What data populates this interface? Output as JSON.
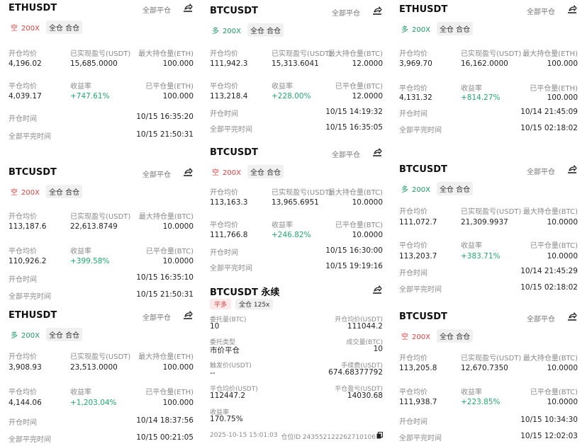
{
  "labels": {
    "close_all": "全部平仓",
    "open_avg": "开仓均价",
    "realized_pnl": "已实现盈亏(USDT)",
    "max_hold_eth": "最大持仓量(ETH)",
    "max_hold_btc": "最大持仓量(BTC)",
    "close_avg": "平仓均价",
    "yield": "收益率",
    "closed_eth": "已平仓量(ETH)",
    "closed_btc": "已平仓量(BTC)",
    "open_time": "开仓时间",
    "full_close_time": "全部平完时间",
    "short": "空",
    "long": "多",
    "leverage": "200X",
    "margin_mode": "全仓 合仓"
  },
  "cards": [
    {
      "symbol": "ETHUSDT",
      "side": "空",
      "leverage": "200X",
      "open_avg": "4,196.02",
      "realized": "15,685.0000",
      "max_hold": "100.000",
      "close_avg": "4,039.17",
      "yield": "+747.61%",
      "closed_qty": "100.000",
      "open_time": "10/15 16:35:20",
      "close_time": "10/15 21:50:31"
    },
    {
      "symbol": "BTCUSDT",
      "side": "多",
      "leverage": "200X",
      "open_avg": "111,942.3",
      "realized": "15,313.6041",
      "max_hold": "12.0000",
      "close_avg": "113,218.4",
      "yield": "+228.00%",
      "closed_qty": "12.0000",
      "open_time": "10/15 14:19:32",
      "close_time": "10/15 16:35:05"
    },
    {
      "symbol": "ETHUSDT",
      "side": "多",
      "leverage": "200X",
      "open_avg": "3,969.70",
      "realized": "16,162.0000",
      "max_hold": "100.000",
      "close_avg": "4,131.32",
      "yield": "+814.27%",
      "closed_qty": "100.000",
      "open_time": "10/14 21:45:09",
      "close_time": "10/15 02:18:02"
    },
    {
      "symbol": "BTCUSDT",
      "side": "空",
      "leverage": "200X",
      "open_avg": "113,187.6",
      "realized": "22,613.8749",
      "max_hold": "10.0000",
      "close_avg": "110,926.2",
      "yield": "+399.58%",
      "closed_qty": "10.0000",
      "open_time": "10/15 16:35:10",
      "close_time": "10/15 21:50:31"
    },
    {
      "symbol": "BTCUSDT",
      "side": "空",
      "leverage": "200X",
      "open_avg": "113,163.3",
      "realized": "13,965.6951",
      "max_hold": "10.0000",
      "close_avg": "111,766.8",
      "yield": "+246.82%",
      "closed_qty": "10.0000",
      "open_time": "10/15 16:30:00",
      "close_time": "10/15 19:19:16"
    },
    {
      "symbol": "BTCUSDT",
      "side": "多",
      "leverage": "200X",
      "open_avg": "111,072.7",
      "realized": "21,309.9937",
      "max_hold": "10.0000",
      "close_avg": "113,203.7",
      "yield": "+383.71%",
      "closed_qty": "10.0000",
      "open_time": "10/14 21:45:29",
      "close_time": "10/15 02:18:02"
    },
    {
      "symbol": "ETHUSDT",
      "side": "多",
      "leverage": "200X",
      "open_avg": "3,908.93",
      "realized": "23,513.0000",
      "max_hold": "100.000",
      "close_avg": "4,144.06",
      "yield": "+1,203.04%",
      "closed_qty": "100.000",
      "open_time": "10/14 18:37:56",
      "close_time": "10/15 00:21:05"
    },
    {
      "symbol": "BTCUSDT",
      "side": "空",
      "leverage": "200X",
      "open_avg": "113,205.8",
      "realized": "12,670.7350",
      "max_hold": "10.0000",
      "close_avg": "111,938.7",
      "yield": "+223.85%",
      "closed_qty": "10.0000",
      "open_time": "10/15 10:34:30",
      "close_time": "10/15 12:02:03"
    }
  ],
  "perp": {
    "title": "BTCUSDT 永续",
    "tag_side": "平多",
    "tag_mode": "全仓 125x",
    "entrust_qty_label": "委托量(BTC)",
    "entrust_qty": "10",
    "open_avg_label": "开仓均价(USDT)",
    "open_avg": "111044.2",
    "order_type_label": "委托类型",
    "order_type": "市价平仓",
    "filled_label": "成交量(BTC)",
    "filled": "10",
    "trigger_label": "触发价(USDT)",
    "trigger": "--",
    "fee_label": "手续费(USDT)",
    "fee": "674.68377792",
    "close_avg_label": "平仓均价(USDT)",
    "close_avg": "112447.2",
    "close_pnl_label": "平仓盈亏(USDT)",
    "close_pnl": "14030.68",
    "yield_label": "收益率",
    "yield": "170.75%",
    "time": "2025-10-15 15:01:03",
    "position_id": "仓位ID 2435521222627101​06"
  }
}
